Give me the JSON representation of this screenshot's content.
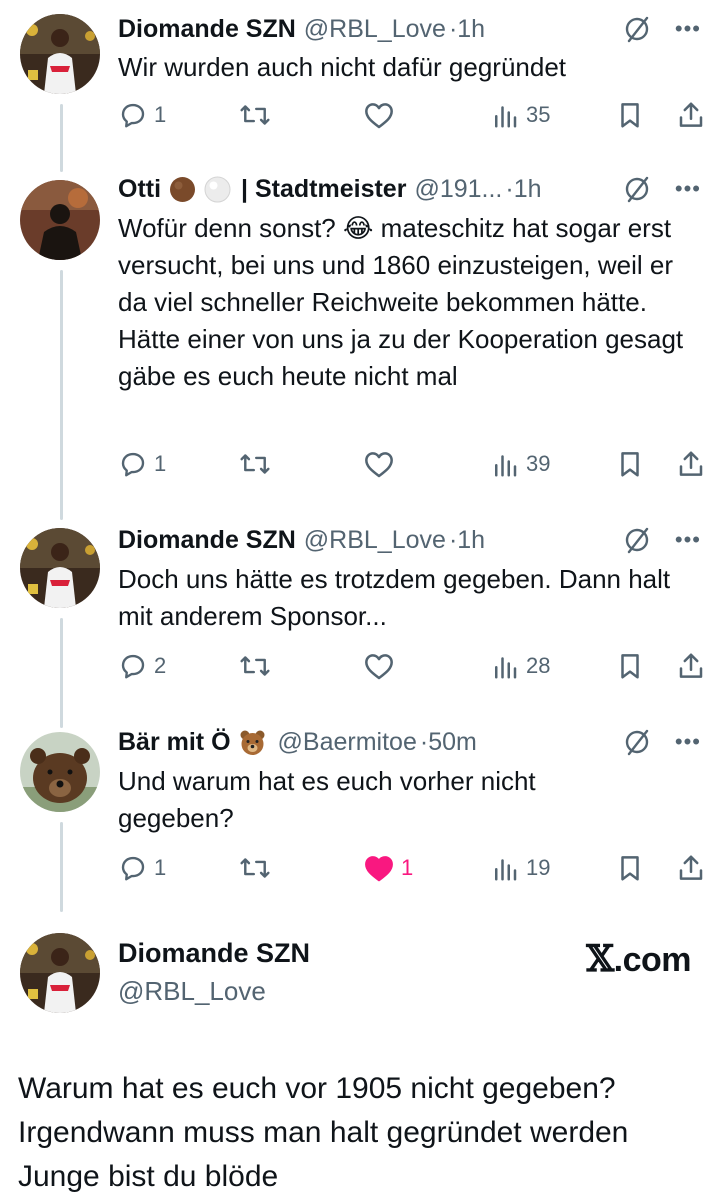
{
  "tweets": [
    {
      "name": "Diomande SZN",
      "handle": "@RBL_Love",
      "dot": "·",
      "time": "1h",
      "text": "Wir wurden auch nicht dafür gegründet",
      "replies": "1",
      "retweets": "",
      "likes": "",
      "views": "35",
      "liked": false
    },
    {
      "name": "Otti",
      "name_suffix": "| Stadtmeister",
      "handle": "@191...",
      "dot": "·",
      "time": "1h",
      "text": "Wofür denn sonst? 😂 mateschitz hat sogar erst versucht, bei uns und 1860 einzusteigen, weil er da viel schneller Reichweite bekommen hätte. Hätte einer von uns ja zu der Kooperation gesagt gäbe es euch heute nicht mal",
      "replies": "1",
      "retweets": "",
      "likes": "",
      "views": "39",
      "liked": false
    },
    {
      "name": "Diomande SZN",
      "handle": "@RBL_Love",
      "dot": "·",
      "time": "1h",
      "text": "Doch uns hätte es trotzdem gegeben. Dann halt mit anderem Sponsor...",
      "replies": "2",
      "retweets": "",
      "likes": "",
      "views": "28",
      "liked": false
    },
    {
      "name": "Bär mit Ö",
      "handle": "@Baermitoe",
      "dot": "·",
      "time": "50m",
      "text": "Und warum hat es euch vorher nicht gegeben?",
      "replies": "1",
      "retweets": "",
      "likes": "1",
      "views": "19",
      "liked": true
    }
  ],
  "quote": {
    "name": "Diomande SZN",
    "handle": "@RBL_Love",
    "brand_mark": "𝕏",
    "brand_text": ".com",
    "text": "Warum hat es euch vor 1905 nicht gegeben? Irgendwann muss man halt gegründet werden Junge bist du blöde"
  },
  "icons": {
    "reply": "reply-icon",
    "retweet": "retweet-icon",
    "like": "heart-icon",
    "views": "views-icon",
    "bookmark": "bookmark-icon",
    "share": "share-icon",
    "grok": "grok-icon",
    "more": "more-icon"
  },
  "colors": {
    "text": "#0f1419",
    "secondary": "#536471",
    "like_active": "#f91880",
    "thread_line": "#cfd9de"
  }
}
